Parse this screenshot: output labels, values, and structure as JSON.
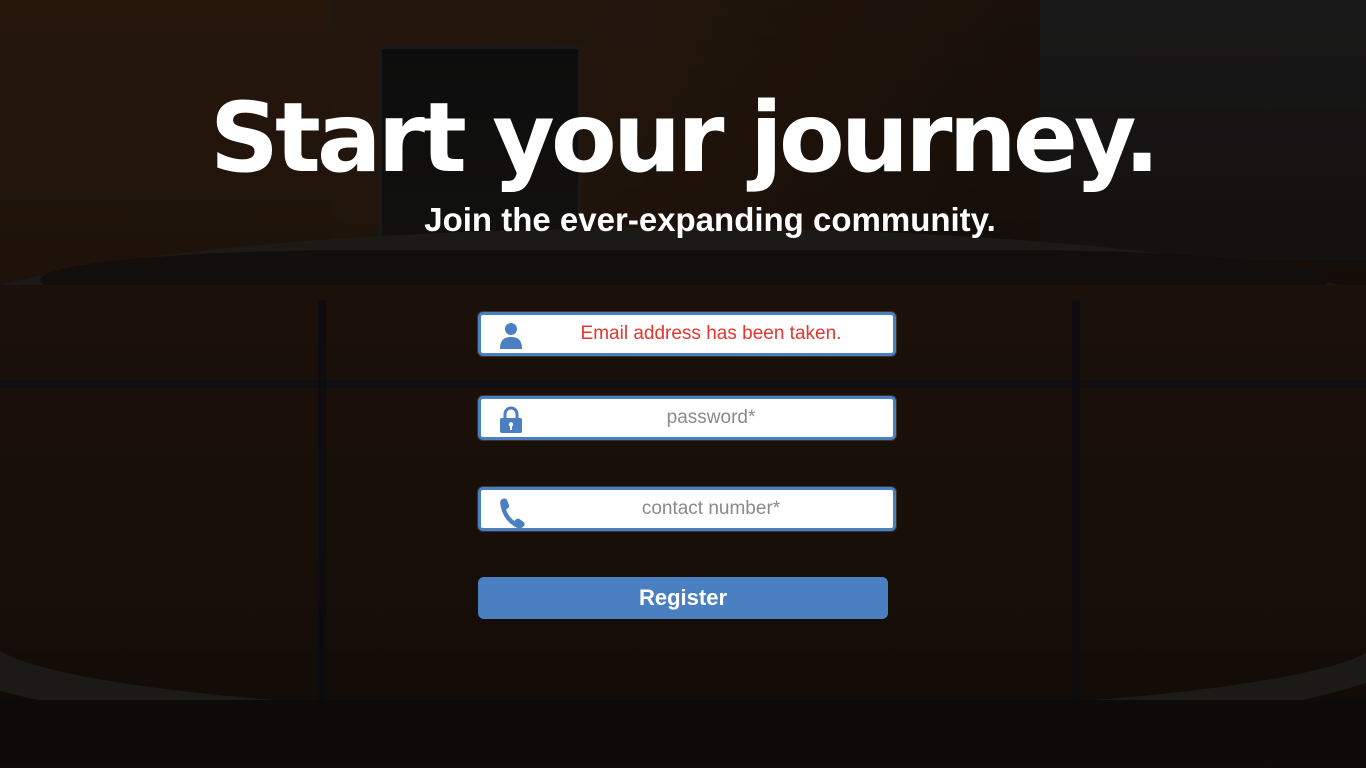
{
  "hero": {
    "title": "Start your journey.",
    "subtitle": "Join the ever-expanding community."
  },
  "form": {
    "email": {
      "placeholder": "Email address has been taken.",
      "icon": "user-icon",
      "state": "error"
    },
    "password": {
      "placeholder": "password*",
      "icon": "lock-icon"
    },
    "contact": {
      "placeholder": "contact number*",
      "icon": "phone-icon"
    },
    "register_label": "Register"
  },
  "colors": {
    "accent": "#4a80c2",
    "error": "#e2362f",
    "placeholder": "#8a8a8a",
    "text": "#ffffff"
  }
}
